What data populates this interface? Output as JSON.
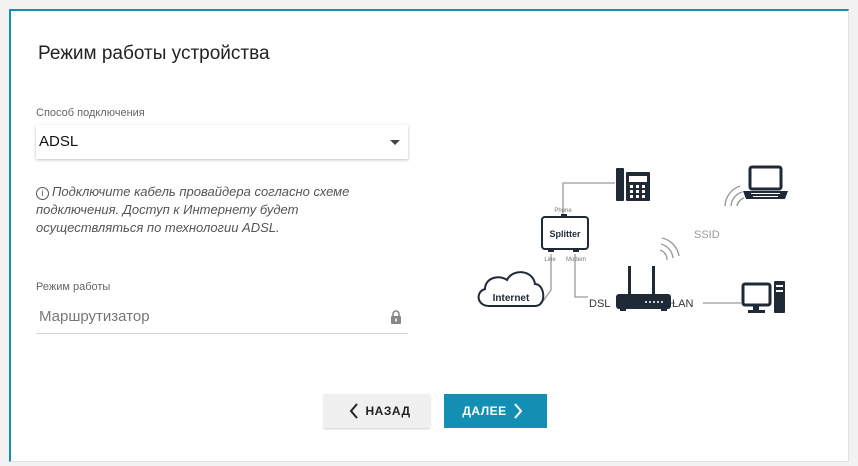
{
  "page": {
    "title": "Режим работы устройства"
  },
  "connection": {
    "label": "Способ подключения",
    "value": "ADSL"
  },
  "info_text": "Подключите кабель провайдера согласно схеме подключения. Доступ к Интернету будет осуществляться по технологии ADSL.",
  "mode": {
    "label": "Режим работы",
    "value": "Маршрутизатор"
  },
  "buttons": {
    "back": "НАЗАД",
    "next": "ДАЛЕЕ"
  },
  "diagram": {
    "splitter": "Splitter",
    "phone_port": "Phone",
    "line_port": "Line",
    "modem_port": "Modem",
    "internet": "Internet",
    "dsl": "DSL",
    "lan": "LAN",
    "ssid": "SSID"
  },
  "colors": {
    "accent": "#138fb4",
    "device": "#1f2a36"
  }
}
